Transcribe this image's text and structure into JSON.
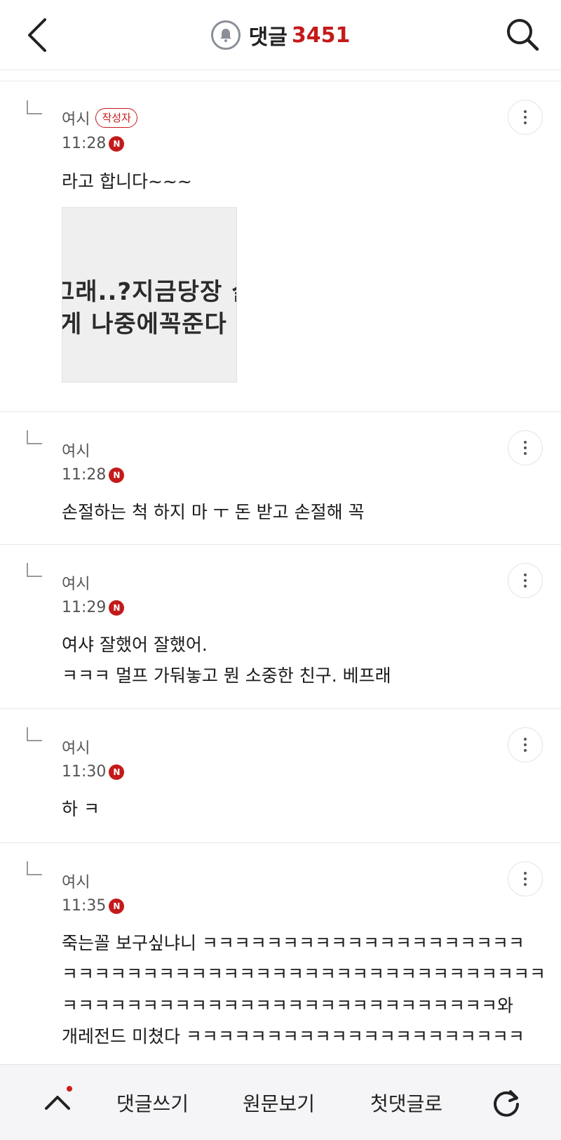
{
  "header": {
    "title": "댓글",
    "count": "3451"
  },
  "comments": [
    {
      "author": "여시",
      "badge": "작성자",
      "time": "11:28",
      "new_badge": "N",
      "lines": [
        "라고 합니다~~~"
      ],
      "sticker_lines": [
        "그래..?지금당장 싫",
        "게 나중에꼭준다"
      ]
    },
    {
      "author": "여시",
      "time": "11:28",
      "new_badge": "N",
      "lines": [
        "손절하는 척 하지 마 ㅜ 돈 받고 손절해 꼭"
      ]
    },
    {
      "author": "여시",
      "time": "11:29",
      "new_badge": "N",
      "lines": [
        "여샤 잘했어 잘했어.",
        "ㅋㅋㅋ 멀프 가둬놓고 뭔 소중한 친구. 베프래"
      ]
    },
    {
      "author": "여시",
      "time": "11:30",
      "new_badge": "N",
      "lines": [
        "하 ㅋ"
      ]
    },
    {
      "author": "여시",
      "time": "11:35",
      "new_badge": "N",
      "lines": [
        "죽는꼴 보구싶냐니 ㅋㅋㅋㅋㅋㅋㅋㅋㅋㅋㅋㅋㅋㅋㅋㅋㅋㅋㅋㅋ",
        "ㅋㅋㅋㅋㅋㅋㅋㅋㅋㅋㅋㅋㅋㅋㅋㅋㅋㅋㅋㅋㅋㅋㅋㅋㅋㅋㅋㅋㅋㅋ",
        "ㅋㅋㅋㅋㅋㅋㅋㅋㅋㅋㅋㅋㅋㅋㅋㅋㅋㅋㅋㅋㅋㅋㅋㅋㅋㅋㅋ와",
        "개레전드 미쳤다 ㅋㅋㅋㅋㅋㅋㅋㅋㅋㅋㅋㅋㅋㅋㅋㅋㅋㅋㅋㅋㅋ"
      ]
    }
  ],
  "bottom_bar": {
    "write_label": "댓글쓰기",
    "original_label": "원문보기",
    "first_label": "첫댓글로"
  },
  "colors": {
    "accent": "#c41a1a",
    "text": "#1a1a1a",
    "muted": "#555555"
  }
}
